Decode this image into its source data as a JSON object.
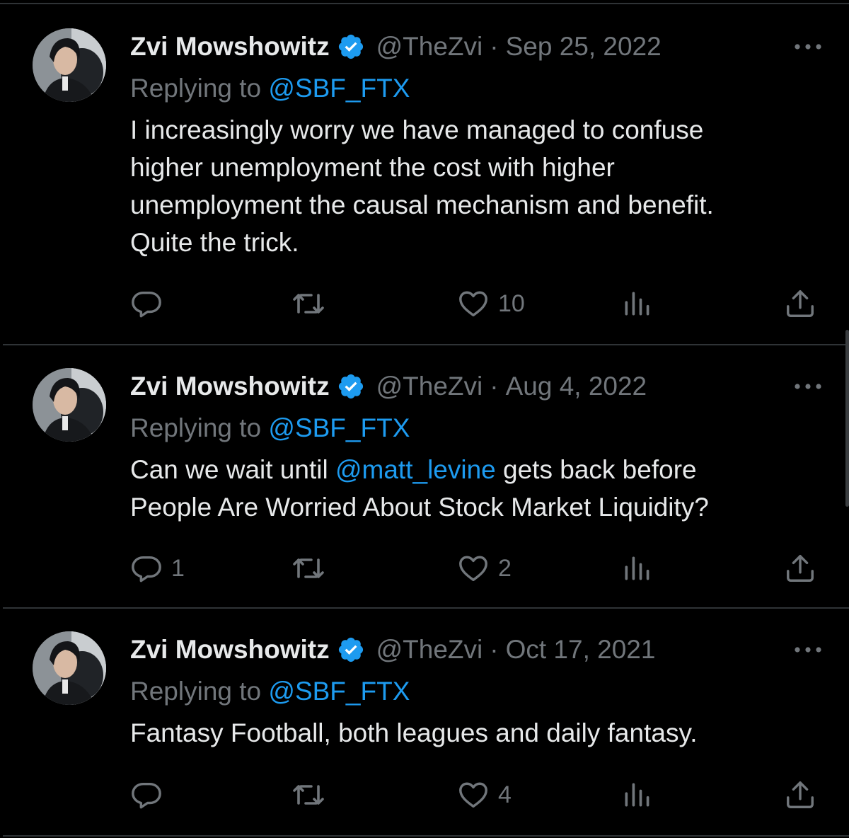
{
  "tweets": [
    {
      "author_name": "Zvi Mowshowitz",
      "handle": "@TheZvi",
      "separator": "·",
      "date": "Sep 25, 2022",
      "replying_prefix": "Replying to",
      "replying_to": "@SBF_FTX",
      "text_lines": [
        "I increasingly worry we have managed to confuse",
        "higher unemployment the cost with higher",
        "unemployment the causal mechanism and benefit.",
        "Quite the trick."
      ],
      "replies": "",
      "retweets": "",
      "likes": "10"
    },
    {
      "author_name": "Zvi Mowshowitz",
      "handle": "@TheZvi",
      "separator": "·",
      "date": "Aug 4, 2022",
      "replying_prefix": "Replying to",
      "replying_to": "@SBF_FTX",
      "text_line1_pre": "Can we wait until ",
      "text_line1_mention": "@matt_levine",
      "text_line1_post": " gets back before",
      "text_line2": "People Are Worried About Stock Market Liquidity?",
      "replies": "1",
      "retweets": "",
      "likes": "2"
    },
    {
      "author_name": "Zvi Mowshowitz",
      "handle": "@TheZvi",
      "separator": "·",
      "date": "Oct 17, 2021",
      "replying_prefix": "Replying to",
      "replying_to": "@SBF_FTX",
      "text_lines": [
        "Fantasy Football, both leagues and daily fantasy."
      ],
      "replies": "",
      "retweets": "",
      "likes": "4"
    }
  ],
  "colors": {
    "background": "#000000",
    "primary_text": "#e7e9ea",
    "secondary_text": "#71767b",
    "link": "#1d9bf0",
    "verified_badge": "#1d9bf0",
    "divider": "#2f3336"
  },
  "icons": {
    "avatar": "profile-photo",
    "verified": "verified-badge-icon",
    "more": "more-dots-icon",
    "reply": "reply-bubble-icon",
    "retweet": "retweet-icon",
    "like": "heart-icon",
    "views": "views-bar-chart-icon",
    "share": "share-upload-icon"
  }
}
